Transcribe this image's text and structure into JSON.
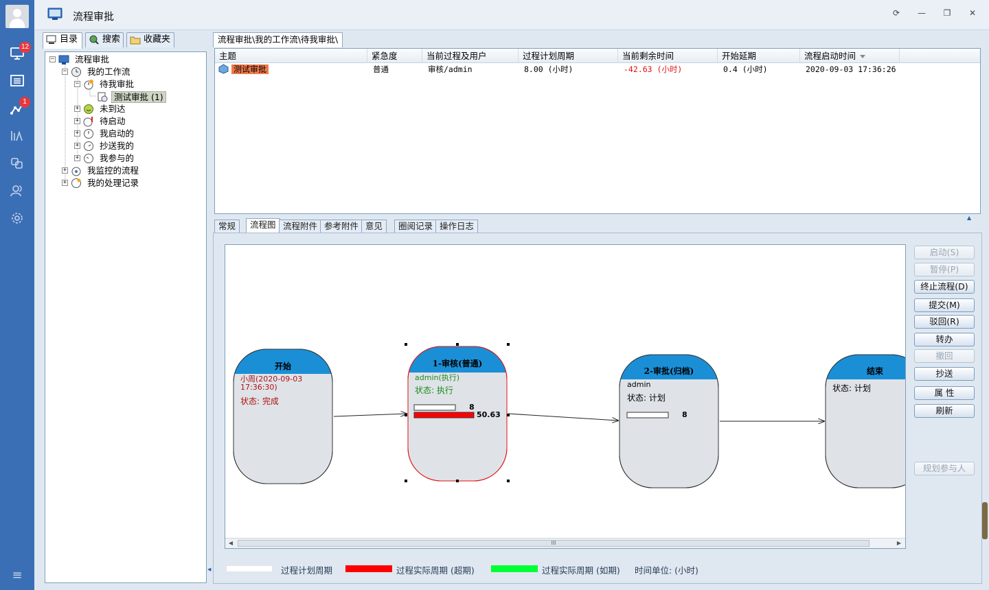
{
  "rail": {
    "items": [
      {
        "icon": "monitor-icon",
        "badge": "12"
      },
      {
        "icon": "list-icon",
        "badge": ""
      },
      {
        "icon": "workflow-icon",
        "badge": "1"
      },
      {
        "icon": "chart-icon",
        "badge": ""
      },
      {
        "icon": "transfer-icon",
        "badge": ""
      },
      {
        "icon": "users-icon",
        "badge": ""
      },
      {
        "icon": "gear-icon",
        "badge": ""
      }
    ],
    "menu_icon": "≡"
  },
  "window": {
    "title": "流程审批",
    "buttons": [
      "⟳",
      "—",
      "❐",
      "✕"
    ]
  },
  "left_tabs": [
    "目录",
    "搜索",
    "收藏夹"
  ],
  "tree": [
    {
      "label": "流程审批",
      "level": 0,
      "exp": "−"
    },
    {
      "label": "我的工作流",
      "level": 1,
      "exp": "−"
    },
    {
      "label": "待我审批",
      "level": 2,
      "exp": "−"
    },
    {
      "label": "测试审批 (1)",
      "level": 3,
      "exp": "",
      "selected": true
    },
    {
      "label": "未到达",
      "level": 2,
      "exp": "+"
    },
    {
      "label": "待启动",
      "level": 2,
      "exp": "+"
    },
    {
      "label": "我启动的",
      "level": 2,
      "exp": "+"
    },
    {
      "label": "抄送我的",
      "level": 2,
      "exp": "+"
    },
    {
      "label": "我参与的",
      "level": 2,
      "exp": "+"
    },
    {
      "label": "我监控的流程",
      "level": 1,
      "exp": "+"
    },
    {
      "label": "我的处理记录",
      "level": 1,
      "exp": "+"
    }
  ],
  "breadcrumb": "流程审批\\我的工作流\\待我审批\\",
  "list": {
    "headers": [
      "主题",
      "紧急度",
      "当前过程及用户",
      "过程计划周期",
      "当前剩余时间",
      "开始延期",
      "流程启动时间"
    ],
    "row": {
      "subject": "测试审批",
      "urgency": "普通",
      "current": "审核/admin",
      "plan": "8.00 (小时)",
      "remaining": "-42.63 (小时)",
      "delay": "0.4 (小时)",
      "start": "2020-09-03 17:36:26"
    }
  },
  "bottom_tabs": [
    "常规",
    "流程图",
    "流程附件",
    "参考附件",
    "意见",
    "圈阅记录",
    "操作日志"
  ],
  "flow": {
    "nodes": [
      {
        "title": "开始",
        "user": "小周(2020-09-03 17:36:30)",
        "status": "状态: 完成"
      },
      {
        "title": "1-审核(普通)",
        "user": "admin(执行)",
        "status": "状态: 执行",
        "plan_value": "8",
        "actual_value": "50.63"
      },
      {
        "title": "2-审批(归档)",
        "user": "admin",
        "status": "状态: 计划",
        "plan_value": "8"
      },
      {
        "title": "结束",
        "status": "状态: 计划"
      }
    ]
  },
  "side_buttons": [
    {
      "label": "启动(S)",
      "enabled": false
    },
    {
      "label": "暂停(P)",
      "enabled": false
    },
    {
      "label": "终止流程(D)",
      "enabled": true
    },
    {
      "label": "提交(M)",
      "enabled": true
    },
    {
      "label": "驳回(R)",
      "enabled": true
    },
    {
      "label": "转办",
      "enabled": true
    },
    {
      "label": "撤回",
      "enabled": false
    },
    {
      "label": "抄送",
      "enabled": true
    },
    {
      "label": "属 性",
      "enabled": true
    },
    {
      "label": "刷新",
      "enabled": true
    },
    {
      "label": "规划参与人",
      "enabled": false
    }
  ],
  "legend": {
    "plan": "过程计划周期",
    "actual_over": "过程实际周期 (超期)",
    "actual_ok": "过程实际周期 (如期)",
    "unit": "时间单位: (小时)",
    "colors": {
      "plan": "#ffffff",
      "over": "#ff0000",
      "ok": "#00ff33"
    }
  },
  "scroll_thumb_grip": "III",
  "scroll_arrows": [
    "◀",
    "▶"
  ]
}
